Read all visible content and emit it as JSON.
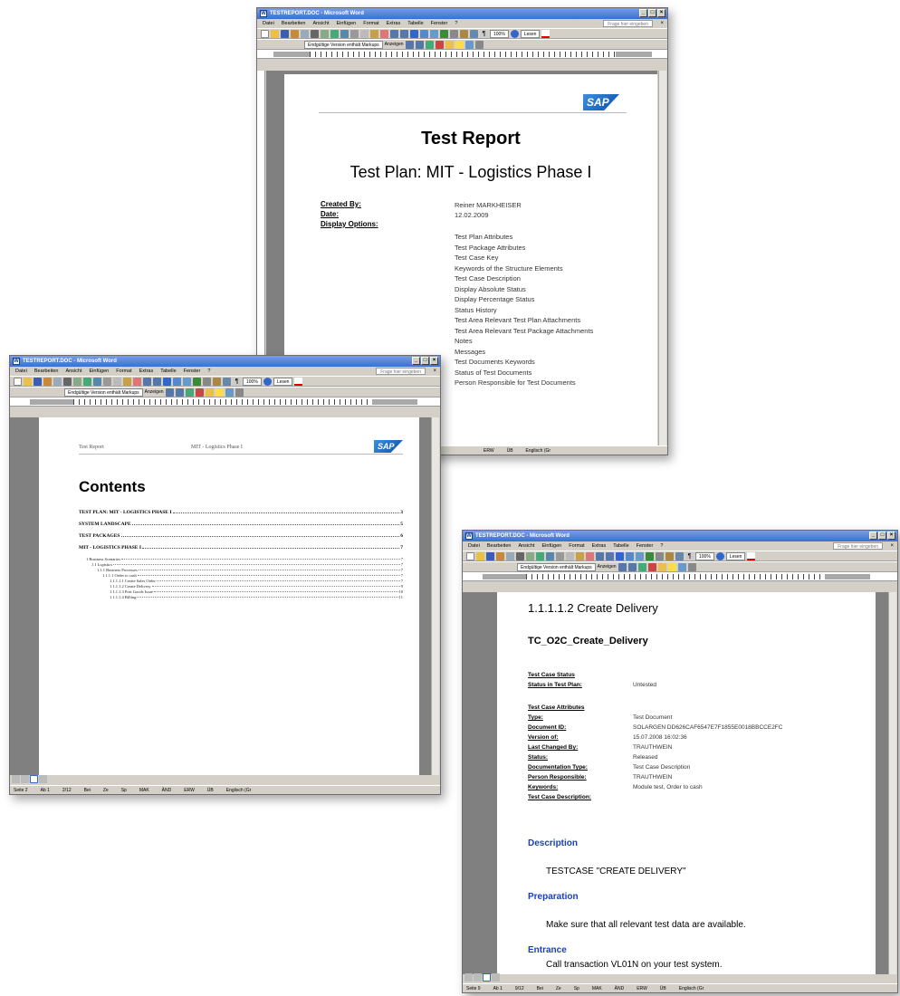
{
  "word": {
    "menus": [
      "Datei",
      "Bearbeiten",
      "Ansicht",
      "Einfügen",
      "Format",
      "Extras",
      "Tabelle",
      "Fenster",
      "?"
    ],
    "ask_placeholder": "Frage hier eingeben",
    "zoom": "100%",
    "lesen": "Lesen",
    "markup_mode": "Endgültige Version enthält Markups",
    "show_label": "Anzeigen",
    "status_extra": [
      "MAK",
      "ÄND",
      "ERW",
      "ÜB",
      "Englisch (Gr"
    ]
  },
  "window1": {
    "title": "TESTREPORT.DOC - Microsoft Word",
    "doc": {
      "title": "Test Report",
      "subtitle": "Test Plan: MIT - Logistics Phase I",
      "created_by_label": "Created By:",
      "created_by": "Reiner MARKHEISER",
      "date_label": "Date:",
      "date": "12.02.2009",
      "display_options_label": "Display Options:",
      "options": [
        "Test Plan Attributes",
        "Test Package Attributes",
        "Test Case Key",
        "Keywords of the Structure Elements",
        "Test Case Description",
        "Display Absolute Status",
        "Display Percentage Status",
        "Status History",
        "Test Area Relevant Test Plan Attachments",
        "Test Area Relevant Test Package Attachments",
        "Notes",
        "Messages",
        "Test Documents Keywords",
        "Status of Test Documents",
        "Person Responsible for Test Documents"
      ]
    }
  },
  "window2": {
    "title": "TESTREPORT.DOC - Microsoft Word",
    "header_left": "Test Report",
    "header_center": "MIT - Logistics Phase I",
    "contents_title": "Contents",
    "toc": [
      {
        "text": "TEST PLAN: MIT - LOGISTICS PHASE I",
        "page": "3"
      },
      {
        "text": "SYSTEM LANDSCAPE",
        "page": "5"
      },
      {
        "text": "TEST PACKAGES",
        "page": "6"
      },
      {
        "text": "MIT - LOGISTICS PHASE I",
        "page": "7"
      }
    ],
    "toc_sub": [
      {
        "text": "1  Business Scenarios",
        "page": "7"
      },
      {
        "text": "1.1  Logistics",
        "page": "7"
      },
      {
        "text": "1.1.1  Business Processes",
        "page": "7"
      },
      {
        "text": "1.1.1.1  Order to cash",
        "page": "7"
      },
      {
        "text": "1.1.1.1.1  Create Sales Order",
        "page": "7"
      },
      {
        "text": "1.1.1.1.2  Create Delivery",
        "page": "9"
      },
      {
        "text": "1.1.1.1.3  Post Goods Issue",
        "page": "10"
      },
      {
        "text": "1.1.1.1.4  Billing",
        "page": "11"
      }
    ],
    "status": {
      "seite": "Seite 2",
      "ab": "Ab 1",
      "pages": "2/12",
      "bei": "Bei",
      "ze": "Ze",
      "sp": "Sp"
    }
  },
  "window3": {
    "title": "TESTREPORT.DOC - Microsoft Word",
    "heading": "1.1.1.1.2  Create Delivery",
    "tc_name": "TC_O2C_Create_Delivery",
    "status_section": "Test Case Status",
    "status_in_plan_label": "Status in Test Plan:",
    "status_in_plan": "Untested",
    "attributes_section": "Test Case Attributes",
    "attributes": [
      {
        "label": "Type:",
        "value": "Test Document"
      },
      {
        "label": "Document ID:",
        "value": "SOLARGEN  DD626CAF6547E7F1855E0018BBCCE2FC"
      },
      {
        "label": "Version of:",
        "value": "15.07.2008 16:02:36"
      },
      {
        "label": "Last Changed By:",
        "value": "TRAUTHWEIN"
      },
      {
        "label": "Status:",
        "value": "Released"
      },
      {
        "label": "Documentation Type:",
        "value": "Test Case Description"
      },
      {
        "label": "Person Responsible:",
        "value": "TRAUTHWEIN"
      },
      {
        "label": "Keywords:",
        "value": "Module test, Order to cash"
      },
      {
        "label": "Test Case Description:",
        "value": ""
      }
    ],
    "description_heading": "Description",
    "description_text": "TESTCASE \"CREATE DELIVERY\"",
    "preparation_heading": "Preparation",
    "preparation_text": "Make sure that all relevant test data are available.",
    "entrance_heading": "Entrance",
    "entrance_text": "Call transaction VL01N on your test system.",
    "status": {
      "seite": "Seite 9",
      "ab": "Ab 1",
      "pages": "9/12",
      "bei": "Bei",
      "ze": "Ze",
      "sp": "Sp"
    }
  },
  "logo": "SAP",
  "colors": {
    "title_bar": "#3b6fd5",
    "heading_blue": "#1a3ec0",
    "workspace": "#808080",
    "chrome": "#d4d0c8"
  }
}
